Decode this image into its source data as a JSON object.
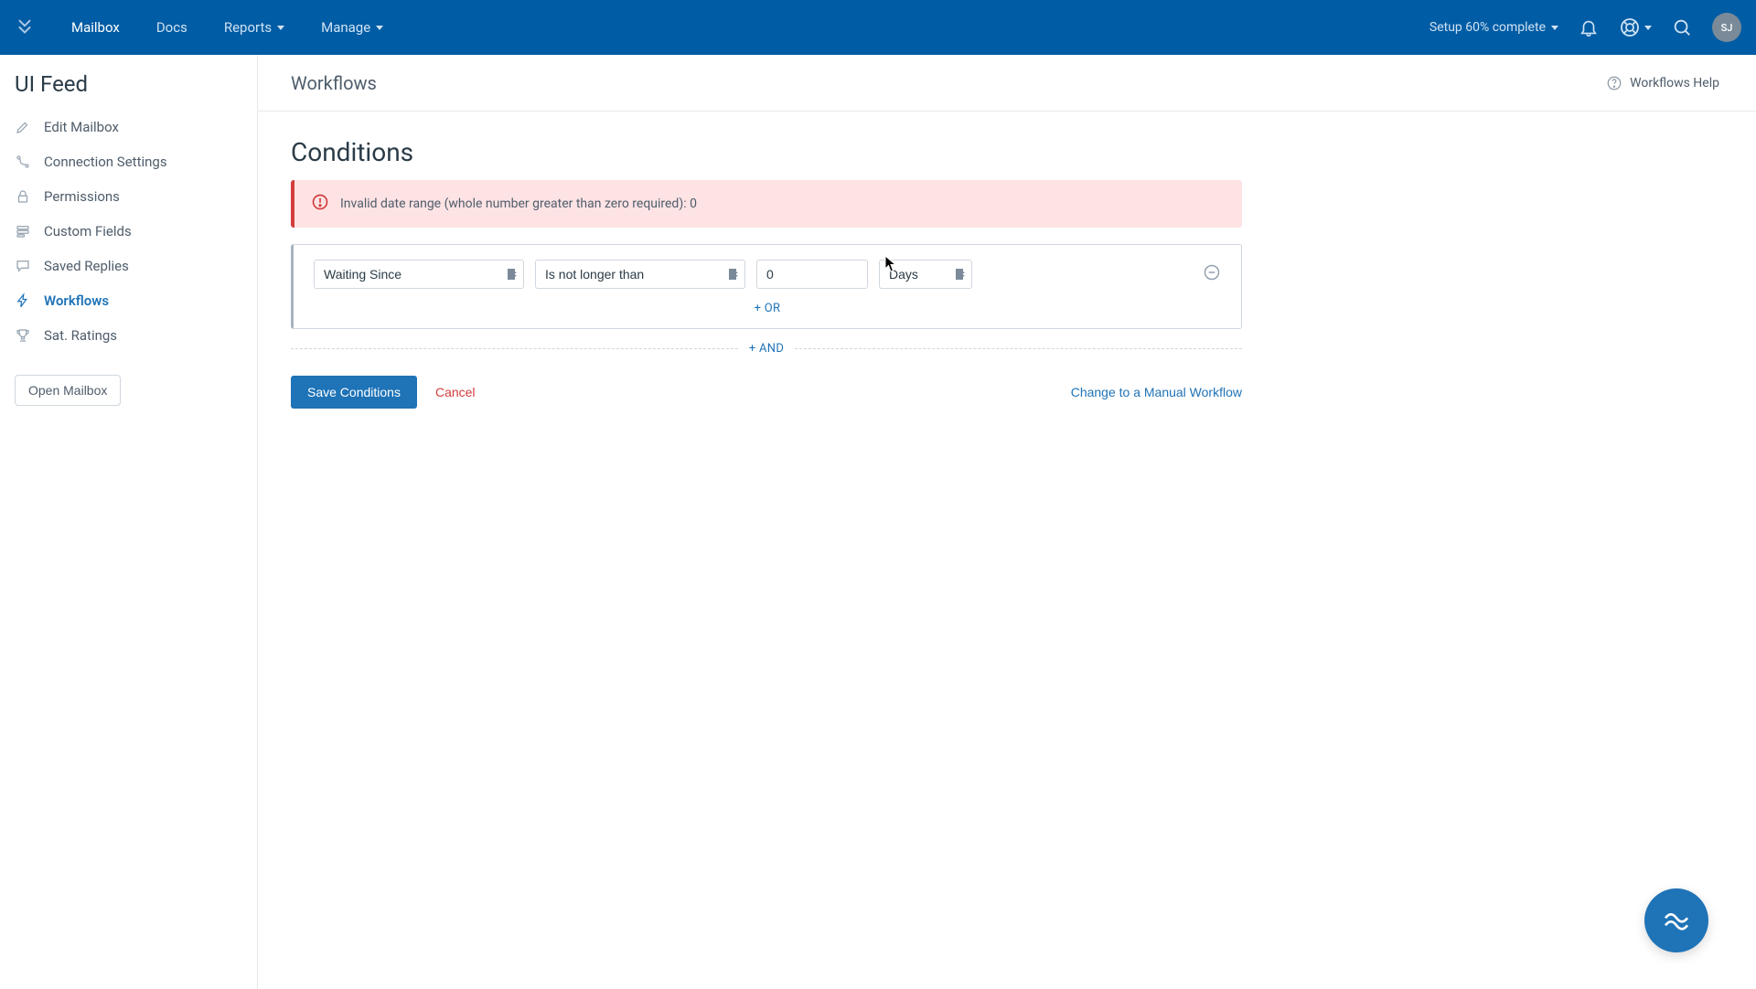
{
  "topbar": {
    "nav": {
      "mailbox": "Mailbox",
      "docs": "Docs",
      "reports": "Reports",
      "manage": "Manage"
    },
    "setup": "Setup 60% complete",
    "avatar": "SJ"
  },
  "sidebar": {
    "title": "UI Feed",
    "items": [
      {
        "label": "Edit Mailbox"
      },
      {
        "label": "Connection Settings"
      },
      {
        "label": "Permissions"
      },
      {
        "label": "Custom Fields"
      },
      {
        "label": "Saved Replies"
      },
      {
        "label": "Workflows"
      },
      {
        "label": "Sat. Ratings"
      }
    ],
    "open_mailbox": "Open Mailbox"
  },
  "header": {
    "title": "Workflows",
    "help": "Workflows Help"
  },
  "page": {
    "title": "Conditions",
    "notice": "Invalid date range (whole number greater than zero required): 0",
    "condition": {
      "field": "Waiting Since",
      "operator": "Is not longer than",
      "value": "0",
      "unit": "Days"
    },
    "or": "+ OR",
    "and": "+ AND",
    "save": "Save Conditions",
    "cancel": "Cancel",
    "change": "Change to a Manual Workflow"
  }
}
